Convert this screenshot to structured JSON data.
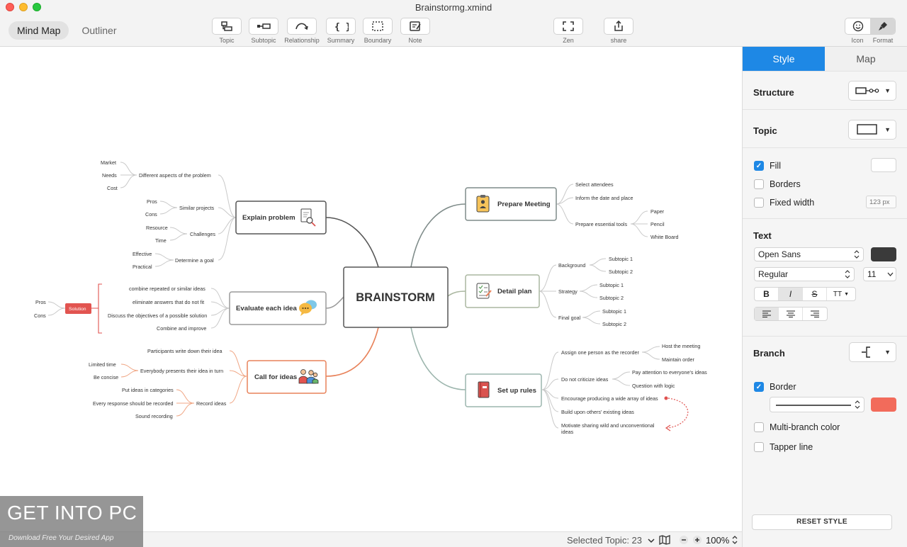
{
  "window": {
    "title": "Brainstormg.xmind"
  },
  "mode_tabs": {
    "mind_map": "Mind Map",
    "outliner": "Outliner"
  },
  "toolbar": {
    "topic": "Topic",
    "subtopic": "Subtopic",
    "relationship": "Relationship",
    "summary": "Summary",
    "boundary": "Boundary",
    "note": "Note",
    "zen": "Zen",
    "share": "share",
    "icon": "Icon",
    "format": "Format"
  },
  "panel": {
    "tabs": {
      "style": "Style",
      "map": "Map"
    },
    "structure": {
      "title": "Structure"
    },
    "topic": {
      "title": "Topic"
    },
    "fill": {
      "label": "Fill",
      "checked": true,
      "color": "#ffffff"
    },
    "borders": {
      "label": "Borders",
      "checked": false
    },
    "fixed_width": {
      "label": "Fixed width",
      "checked": false,
      "placeholder": "123 px"
    },
    "text": {
      "title": "Text",
      "font": "Open Sans",
      "weight": "Regular",
      "size": "11",
      "color": "#3a3a3a",
      "style_buttons": [
        "B",
        "I",
        "S",
        "TT"
      ]
    },
    "branch": {
      "title": "Branch"
    },
    "border": {
      "label": "Border",
      "checked": true,
      "color": "#f26b5b"
    },
    "multi_branch_color": {
      "label": "Multi-branch color",
      "checked": false
    },
    "tapper_line": {
      "label": "Tapper line",
      "checked": false
    },
    "reset": "RESET STYLE"
  },
  "status": {
    "selected_label": "Selected Topic: 23",
    "zoom": "100%"
  },
  "watermark": {
    "title": "GET INTO PC",
    "subtitle": "Download Free Your Desired App"
  },
  "mindmap": {
    "central": "BRAINSTORM",
    "explain": {
      "label": "Explain problem",
      "branches": [
        {
          "label": "Different aspects of the problem",
          "leaves": [
            "Market",
            "Needs",
            "Cost"
          ]
        },
        {
          "label": "Similar projects",
          "leaves": [
            "Pros",
            "Cons"
          ]
        },
        {
          "label": "Challenges",
          "leaves": [
            "Resource",
            "Time"
          ]
        },
        {
          "label": "Determine a goal",
          "leaves": [
            "Effective",
            "Practical"
          ]
        }
      ]
    },
    "evaluate": {
      "label": "Evaluate each idea",
      "items": [
        "combine repeated or similar ideas",
        "eliminate answers that do not fit",
        "Discuss the objectives of a possible solution",
        "Combine and improve"
      ],
      "summary": "Solution",
      "summary_leaves": [
        "Pros",
        "Cons"
      ]
    },
    "call": {
      "label": "Call for ideas",
      "items": [
        "Participants write down their idea",
        "Everybody presents their idea in turn",
        "Record ideas"
      ],
      "turn_leaves": [
        "Limited time",
        "Be concise"
      ],
      "record_leaves": [
        "Put ideas in categories",
        "Every response should be recorded",
        "Sound recording"
      ]
    },
    "prepare": {
      "label": "Prepare Meeting",
      "items": [
        "Select attendees",
        "Inform the date and place",
        "Prepare essential tools"
      ],
      "tools": [
        "Paper",
        "Pencil",
        "White Board"
      ]
    },
    "detail": {
      "label": "Detail plan",
      "items": [
        "Background",
        "Strategy",
        "Final goal"
      ],
      "subtopic1": "Subtopic 1",
      "subtopic2": "Subtopic 2"
    },
    "rules": {
      "label": "Set up rules",
      "items": [
        "Assign one person as the recorder",
        "Do not criticize ideas",
        "Encourage producing a wide array of ideas",
        "Build upon others' existing ideas"
      ],
      "last_item_line1": "Motivate sharing wild and unconventional",
      "last_item_line2": "ideas",
      "recorder_leaves": [
        "Host the meeting",
        "Maintain order"
      ],
      "criticize_leaves": [
        "Pay attention to everyone's ideas",
        "Question with logic"
      ]
    }
  }
}
